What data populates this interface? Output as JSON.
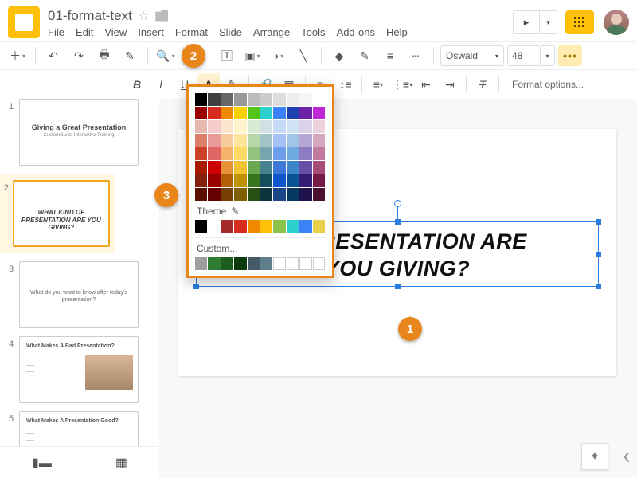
{
  "header": {
    "doc_title": "01-format-text",
    "menus": [
      "File",
      "Edit",
      "View",
      "Insert",
      "Format",
      "Slide",
      "Arrange",
      "Tools",
      "Add-ons",
      "Help"
    ]
  },
  "toolbar": {
    "font": "Oswald",
    "font_size": "48",
    "format_options": "Format options..."
  },
  "color_picker": {
    "theme_label": "Theme",
    "custom_label": "Custom...",
    "standard_rows": [
      [
        "#000000",
        "#404040",
        "#666666",
        "#999999",
        "#bbbbbb",
        "#cccccc",
        "#dddddd",
        "#eeeeee",
        "#f5f5f5",
        "#ffffff"
      ],
      [
        "#9a0000",
        "#d62d20",
        "#ef8a00",
        "#fdd000",
        "#52c41a",
        "#2ecfcf",
        "#3b82f6",
        "#1e40af",
        "#6b21a8",
        "#c026d3"
      ],
      [
        "#e6b8af",
        "#f4cccc",
        "#fce5cd",
        "#fff2cc",
        "#d9ead3",
        "#d0e0e3",
        "#c9daf8",
        "#cfe2f3",
        "#d9d2e9",
        "#ead1dc"
      ],
      [
        "#dd7e6b",
        "#ea9999",
        "#f9cb9c",
        "#ffe599",
        "#b6d7a8",
        "#a2c4c9",
        "#a4c2f4",
        "#9fc5e8",
        "#b4a7d6",
        "#d5a6bd"
      ],
      [
        "#cc4125",
        "#e06666",
        "#f6b26b",
        "#ffd966",
        "#93c47d",
        "#76a5af",
        "#6d9eeb",
        "#6fa8dc",
        "#8e7cc3",
        "#c27ba0"
      ],
      [
        "#a61c00",
        "#cc0000",
        "#e69138",
        "#f1c232",
        "#6aa84f",
        "#45818e",
        "#3c78d8",
        "#3d85c6",
        "#674ea7",
        "#a64d79"
      ],
      [
        "#85200c",
        "#990000",
        "#b45f06",
        "#bf9000",
        "#38761d",
        "#134f5c",
        "#1155cc",
        "#0b5394",
        "#351c75",
        "#741b47"
      ],
      [
        "#5b0f00",
        "#660000",
        "#783f04",
        "#7f6000",
        "#274e13",
        "#0c343d",
        "#1c4587",
        "#073763",
        "#20124d",
        "#4c1130"
      ]
    ],
    "theme_row": [
      "#000000",
      "#ffffff",
      "#a52a2a",
      "#d62d20",
      "#ef8a00",
      "#ffc107",
      "#8bc34a",
      "#2ecfcf",
      "#3b82f6",
      "#ead04a"
    ],
    "custom_row": [
      "#9e9e9e",
      "#2e7d32",
      "#1b5e20",
      "#0d3b0d",
      "#455a64",
      "#607d8b",
      "",
      "",
      "",
      ""
    ]
  },
  "slides": [
    {
      "num": "1",
      "title": "Giving a Great Presentation",
      "subtitle": "CustomGuide Interactive Training"
    },
    {
      "num": "2",
      "text": "WHAT KIND OF PRESENTATION ARE YOU GIVING?"
    },
    {
      "num": "3",
      "text": "What do you want to know after today's presentation?"
    },
    {
      "num": "4",
      "heading": "What Makes A Bad Presentation?"
    },
    {
      "num": "5",
      "heading": "What Makes A Presentation Good?"
    }
  ],
  "canvas": {
    "line1": "OF PRESENTATION ARE",
    "line2": "YOU GIVING?"
  },
  "callouts": {
    "n1": "1",
    "n2": "2",
    "n3": "3"
  }
}
